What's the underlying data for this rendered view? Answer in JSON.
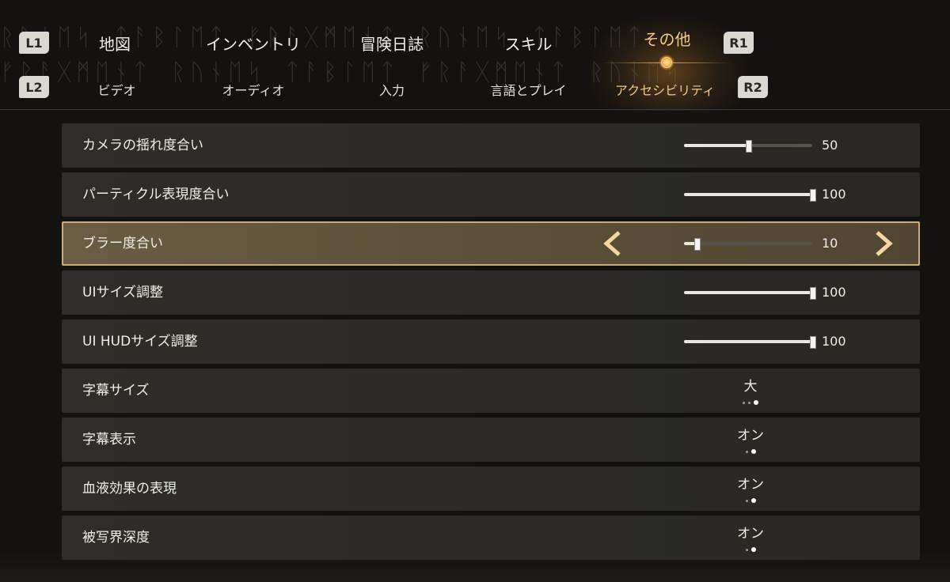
{
  "header": {
    "buttons": {
      "l1": "L1",
      "r1": "R1",
      "l2": "L2",
      "r2": "R2"
    },
    "main_tabs": [
      {
        "label": "地図"
      },
      {
        "label": "インベントリ"
      },
      {
        "label": "冒険日誌"
      },
      {
        "label": "スキル"
      },
      {
        "label": "その他",
        "active": true
      }
    ],
    "sub_tabs": [
      {
        "label": "ビデオ"
      },
      {
        "label": "オーディオ"
      },
      {
        "label": "入力"
      },
      {
        "label": "言語とプレイ"
      },
      {
        "label": "アクセシビリティ",
        "active": true
      }
    ]
  },
  "settings": [
    {
      "label": "カメラの揺れ度合い",
      "type": "slider",
      "value": "50",
      "fraction": 0.5
    },
    {
      "label": "パーティクル表現度合い",
      "type": "slider",
      "value": "100",
      "fraction": 1.0
    },
    {
      "label": "ブラー度合い",
      "type": "slider",
      "value": "10",
      "fraction": 0.1,
      "selected": true
    },
    {
      "label": "UIサイズ調整",
      "type": "slider",
      "value": "100",
      "fraction": 1.0
    },
    {
      "label": "UI HUDサイズ調整",
      "type": "slider",
      "value": "100",
      "fraction": 1.0
    },
    {
      "label": "字幕サイズ",
      "type": "choice",
      "value": "大",
      "options_count": 3,
      "selected_index": 2
    },
    {
      "label": "字幕表示",
      "type": "choice",
      "value": "オン",
      "options_count": 2,
      "selected_index": 1
    },
    {
      "label": "血液効果の表現",
      "type": "choice",
      "value": "オン",
      "options_count": 2,
      "selected_index": 1
    },
    {
      "label": "被写界深度",
      "type": "choice",
      "value": "オン",
      "options_count": 2,
      "selected_index": 1
    }
  ],
  "colors": {
    "accent": "#f3c98a",
    "selected_row": "#5d5038",
    "row_bg": "#2d2b27"
  }
}
